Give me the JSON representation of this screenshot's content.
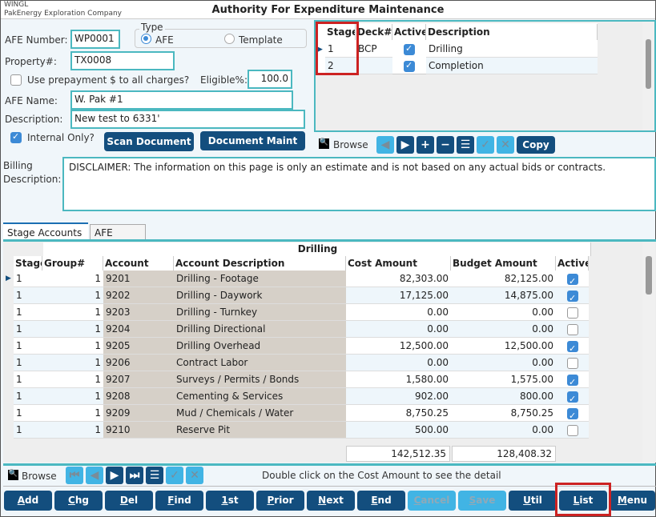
{
  "header": {
    "app": "WINGL",
    "company": "PakEnergy Exploration Company",
    "title": "Authority For Expenditure Maintenance"
  },
  "form": {
    "afe_number_label": "AFE Number:",
    "afe_number": "WP0001",
    "type_label": "Type",
    "type_options": [
      "AFE",
      "Template"
    ],
    "type_selected": "AFE",
    "property_label": "Property#:",
    "property": "TX0008",
    "prepay_label": "Use prepayment $ to all charges?",
    "prepay_checked": false,
    "eligible_label": "Eligible%:",
    "eligible": "100.0",
    "afe_name_label": "AFE Name:",
    "afe_name": "W. Pak #1",
    "description_label": "Description:",
    "description": "New test to 6331'",
    "internal_label": "Internal Only?",
    "internal_checked": true,
    "scan_button": "Scan Document",
    "doc_maint_button": "Document Maint",
    "billing_label": "Billing Description:",
    "billing": "DISCLAIMER:  The information on this page is only an estimate and is not based on any actual bids or contracts."
  },
  "stages": {
    "columns": [
      "Stage",
      "Deck#",
      "Active",
      "Description"
    ],
    "rows": [
      {
        "stage": "1",
        "deck": "BCP",
        "active": true,
        "description": "Drilling"
      },
      {
        "stage": "2",
        "deck": "",
        "active": true,
        "description": "Completion"
      }
    ],
    "browse_label": "Browse",
    "copy_button": "Copy"
  },
  "tabs": [
    {
      "label": "Stage Accounts",
      "active": true
    },
    {
      "label": "AFE Notes",
      "active": false
    }
  ],
  "accounts": {
    "group_title": "Drilling",
    "columns": [
      "Stage",
      "Group#",
      "Account",
      "Account Description",
      "Cost Amount",
      "Budget Amount",
      "Active"
    ],
    "rows": [
      {
        "stage": "1",
        "group": "1",
        "account": "9201",
        "desc": "Drilling - Footage",
        "cost": "82,303.00",
        "budget": "82,125.00",
        "active": true
      },
      {
        "stage": "1",
        "group": "1",
        "account": "9202",
        "desc": "Drilling - Daywork",
        "cost": "17,125.00",
        "budget": "14,875.00",
        "active": true
      },
      {
        "stage": "1",
        "group": "1",
        "account": "9203",
        "desc": "Drilling - Turnkey",
        "cost": "0.00",
        "budget": "0.00",
        "active": false
      },
      {
        "stage": "1",
        "group": "1",
        "account": "9204",
        "desc": "Drilling Directional",
        "cost": "0.00",
        "budget": "0.00",
        "active": false
      },
      {
        "stage": "1",
        "group": "1",
        "account": "9205",
        "desc": "Drilling Overhead",
        "cost": "12,500.00",
        "budget": "12,500.00",
        "active": true
      },
      {
        "stage": "1",
        "group": "1",
        "account": "9206",
        "desc": "Contract Labor",
        "cost": "0.00",
        "budget": "0.00",
        "active": false
      },
      {
        "stage": "1",
        "group": "1",
        "account": "9207",
        "desc": "Surveys / Permits / Bonds",
        "cost": "1,580.00",
        "budget": "1,575.00",
        "active": true
      },
      {
        "stage": "1",
        "group": "1",
        "account": "9208",
        "desc": "Cementing & Services",
        "cost": "902.00",
        "budget": "800.00",
        "active": true
      },
      {
        "stage": "1",
        "group": "1",
        "account": "9209",
        "desc": "Mud / Chemicals / Water",
        "cost": "8,750.25",
        "budget": "8,750.25",
        "active": true
      },
      {
        "stage": "1",
        "group": "1",
        "account": "9210",
        "desc": "Reserve Pit",
        "cost": "500.00",
        "budget": "0.00",
        "active": false
      }
    ],
    "total_cost": "142,512.35",
    "total_budget": "128,408.32"
  },
  "browse_bar": {
    "label": "Browse",
    "hint": "Double click on the Cost Amount to see the detail"
  },
  "buttons": [
    {
      "label": "Add",
      "enabled": true
    },
    {
      "label": "Chg",
      "enabled": true
    },
    {
      "label": "Del",
      "enabled": true
    },
    {
      "label": "Find",
      "enabled": true
    },
    {
      "label": "1st",
      "enabled": true
    },
    {
      "label": "Prior",
      "enabled": true
    },
    {
      "label": "Next",
      "enabled": true
    },
    {
      "label": "End",
      "enabled": true
    },
    {
      "label": "Cancel",
      "enabled": false
    },
    {
      "label": "Save",
      "enabled": false
    },
    {
      "label": "Util",
      "enabled": true
    },
    {
      "label": "List",
      "enabled": true
    },
    {
      "label": "Menu",
      "enabled": true
    }
  ],
  "colors": {
    "accent": "#134e7e",
    "disabled": "#41b4e4",
    "border": "#4bb8c0",
    "highlight": "#cc2222"
  }
}
